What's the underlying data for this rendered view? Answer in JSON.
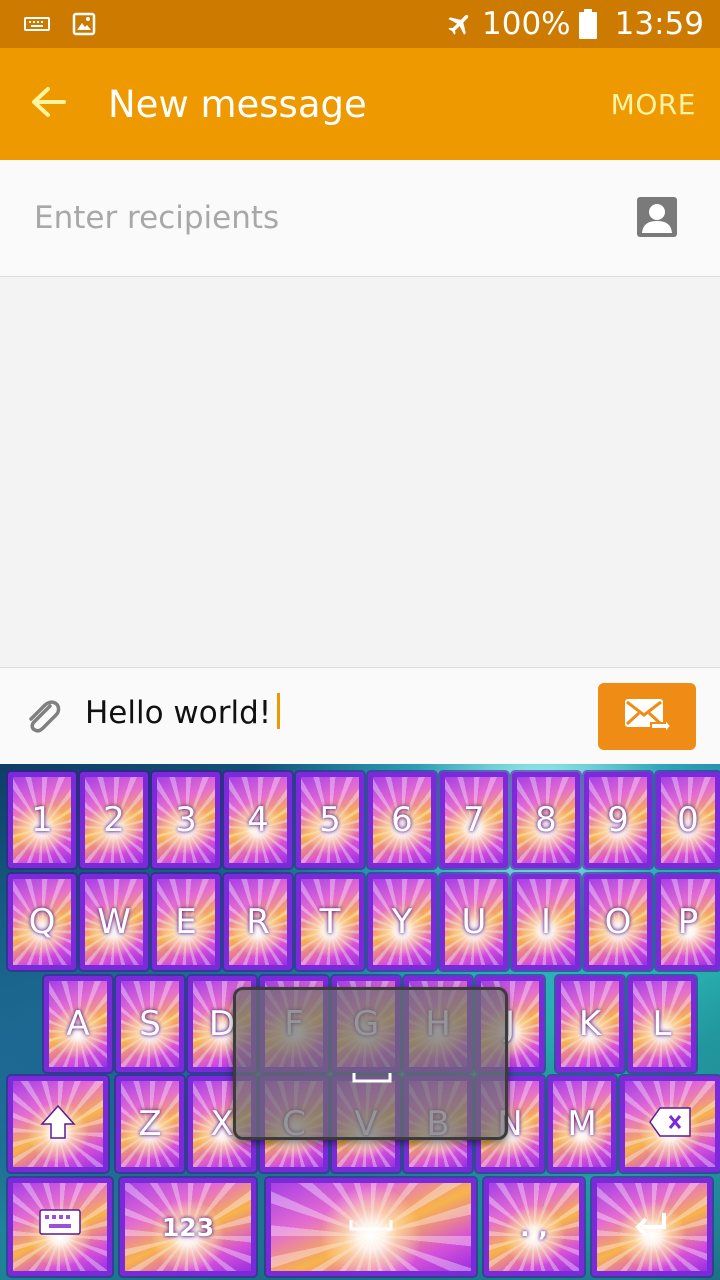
{
  "status_bar": {
    "battery_text": "100%",
    "time": "13:59",
    "icons": [
      "keyboard-icon",
      "image-icon",
      "airplane-mode-icon",
      "battery-icon"
    ]
  },
  "app_bar": {
    "title": "New message",
    "more_label": "MORE"
  },
  "recipients": {
    "placeholder": "Enter recipients"
  },
  "compose": {
    "message": "Hello world!"
  },
  "keyboard": {
    "number_row": [
      "1",
      "2",
      "3",
      "4",
      "5",
      "6",
      "7",
      "8",
      "9",
      "0"
    ],
    "row1": [
      "Q",
      "W",
      "E",
      "R",
      "T",
      "Y",
      "U",
      "I",
      "O",
      "P"
    ],
    "row2": [
      "A",
      "S",
      "D",
      "F",
      "G",
      "H",
      "J",
      "K",
      "L"
    ],
    "row3": [
      "Z",
      "X",
      "C",
      "V",
      "B",
      "N",
      "M"
    ],
    "symbols_label": "123",
    "punct_label": ". ,",
    "preview_key": "space"
  },
  "colors": {
    "status_bar": "#cc7a00",
    "app_bar": "#ee9900",
    "more_text": "#fff3a6",
    "send_button": "#ee8c16",
    "key_border": "#7a2ad8"
  }
}
